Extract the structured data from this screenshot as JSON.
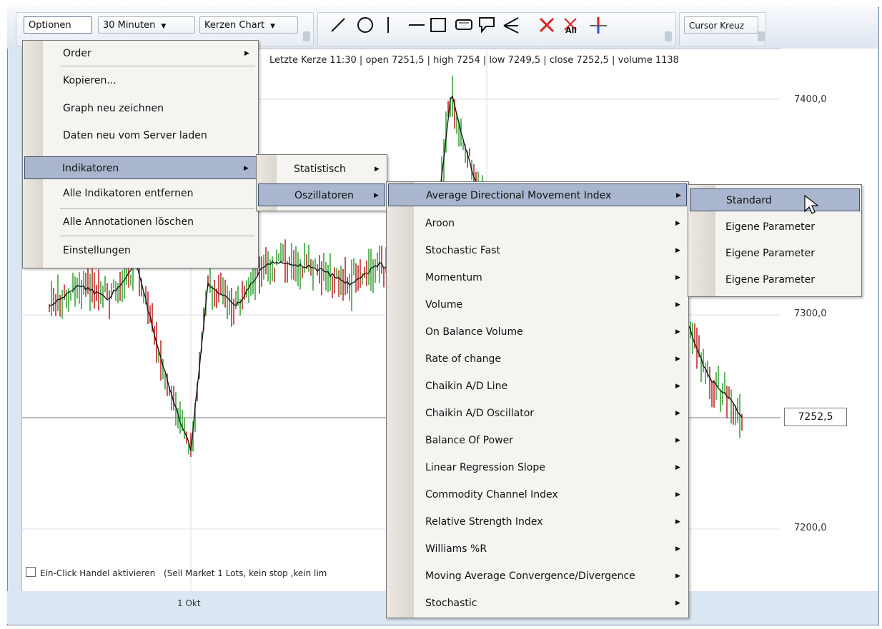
{
  "toolbar": {
    "options_label": "Optionen",
    "timeframe_value": "30 Minuten",
    "chart_type_value": "Kerzen Chart",
    "cursor_value": "Cursor Kreuz",
    "tools": [
      "line-icon",
      "circle-icon",
      "vertical-line-icon",
      "horizontal-line-icon",
      "rectangle-icon",
      "rounded-rectangle-icon",
      "callout-icon",
      "fibonacci-fan-icon",
      "delete-icon",
      "delete-all-icon",
      "crosshair-marker-icon"
    ]
  },
  "chart": {
    "info_line": "Letzte Kerze 11:30 | open 7251,5 | high 7254 | low 7249,5 | close 7252,5 | volume 1138",
    "price_labels": [
      "7400,0",
      "7300,0",
      "7200,0"
    ],
    "current_price": "7252,5",
    "date_label": "1 Okt",
    "one_click_label": "Ein-Click Handel aktivieren",
    "one_click_detail": "(Sell Market 1 Lots, kein stop ,kein lim",
    "colors": {
      "up": "#3aa43a",
      "down": "#c22a2a",
      "ma": "#111111"
    }
  },
  "menu_main": {
    "items": [
      {
        "label": "Order",
        "submenu": true
      },
      {
        "label": "Kopieren...",
        "submenu": false
      },
      {
        "label": "Graph neu zeichnen",
        "submenu": false
      },
      {
        "label": "Daten neu vom Server laden",
        "submenu": false
      },
      {
        "label": "Indikatoren",
        "submenu": true
      },
      {
        "label": "Alle Indikatoren entfernen",
        "submenu": false
      },
      {
        "label": "Alle Annotationen löschen",
        "submenu": false
      },
      {
        "label": "Einstellungen",
        "submenu": false
      }
    ]
  },
  "menu_indicators": {
    "items": [
      {
        "label": "Statistisch",
        "submenu": true
      },
      {
        "label": "Oszillatoren",
        "submenu": true
      }
    ]
  },
  "menu_oscillators": {
    "items": [
      {
        "label": "Average Directional Movement Index"
      },
      {
        "label": "Aroon"
      },
      {
        "label": "Stochastic Fast"
      },
      {
        "label": "Momentum"
      },
      {
        "label": "Volume"
      },
      {
        "label": "On Balance Volume"
      },
      {
        "label": "Rate of change"
      },
      {
        "label": "Chaikin A/D Line"
      },
      {
        "label": "Chaikin A/D Oscillator"
      },
      {
        "label": "Balance Of Power"
      },
      {
        "label": "Linear Regression Slope"
      },
      {
        "label": "Commodity Channel Index"
      },
      {
        "label": "Relative Strength Index"
      },
      {
        "label": "Williams %R"
      },
      {
        "label": "Moving Average Convergence/Divergence"
      },
      {
        "label": "Stochastic"
      }
    ]
  },
  "menu_adx": {
    "items": [
      {
        "label": "Standard"
      },
      {
        "label": "Eigene Parameter"
      },
      {
        "label": "Eigene Parameter"
      },
      {
        "label": "Eigene Parameter"
      }
    ]
  }
}
